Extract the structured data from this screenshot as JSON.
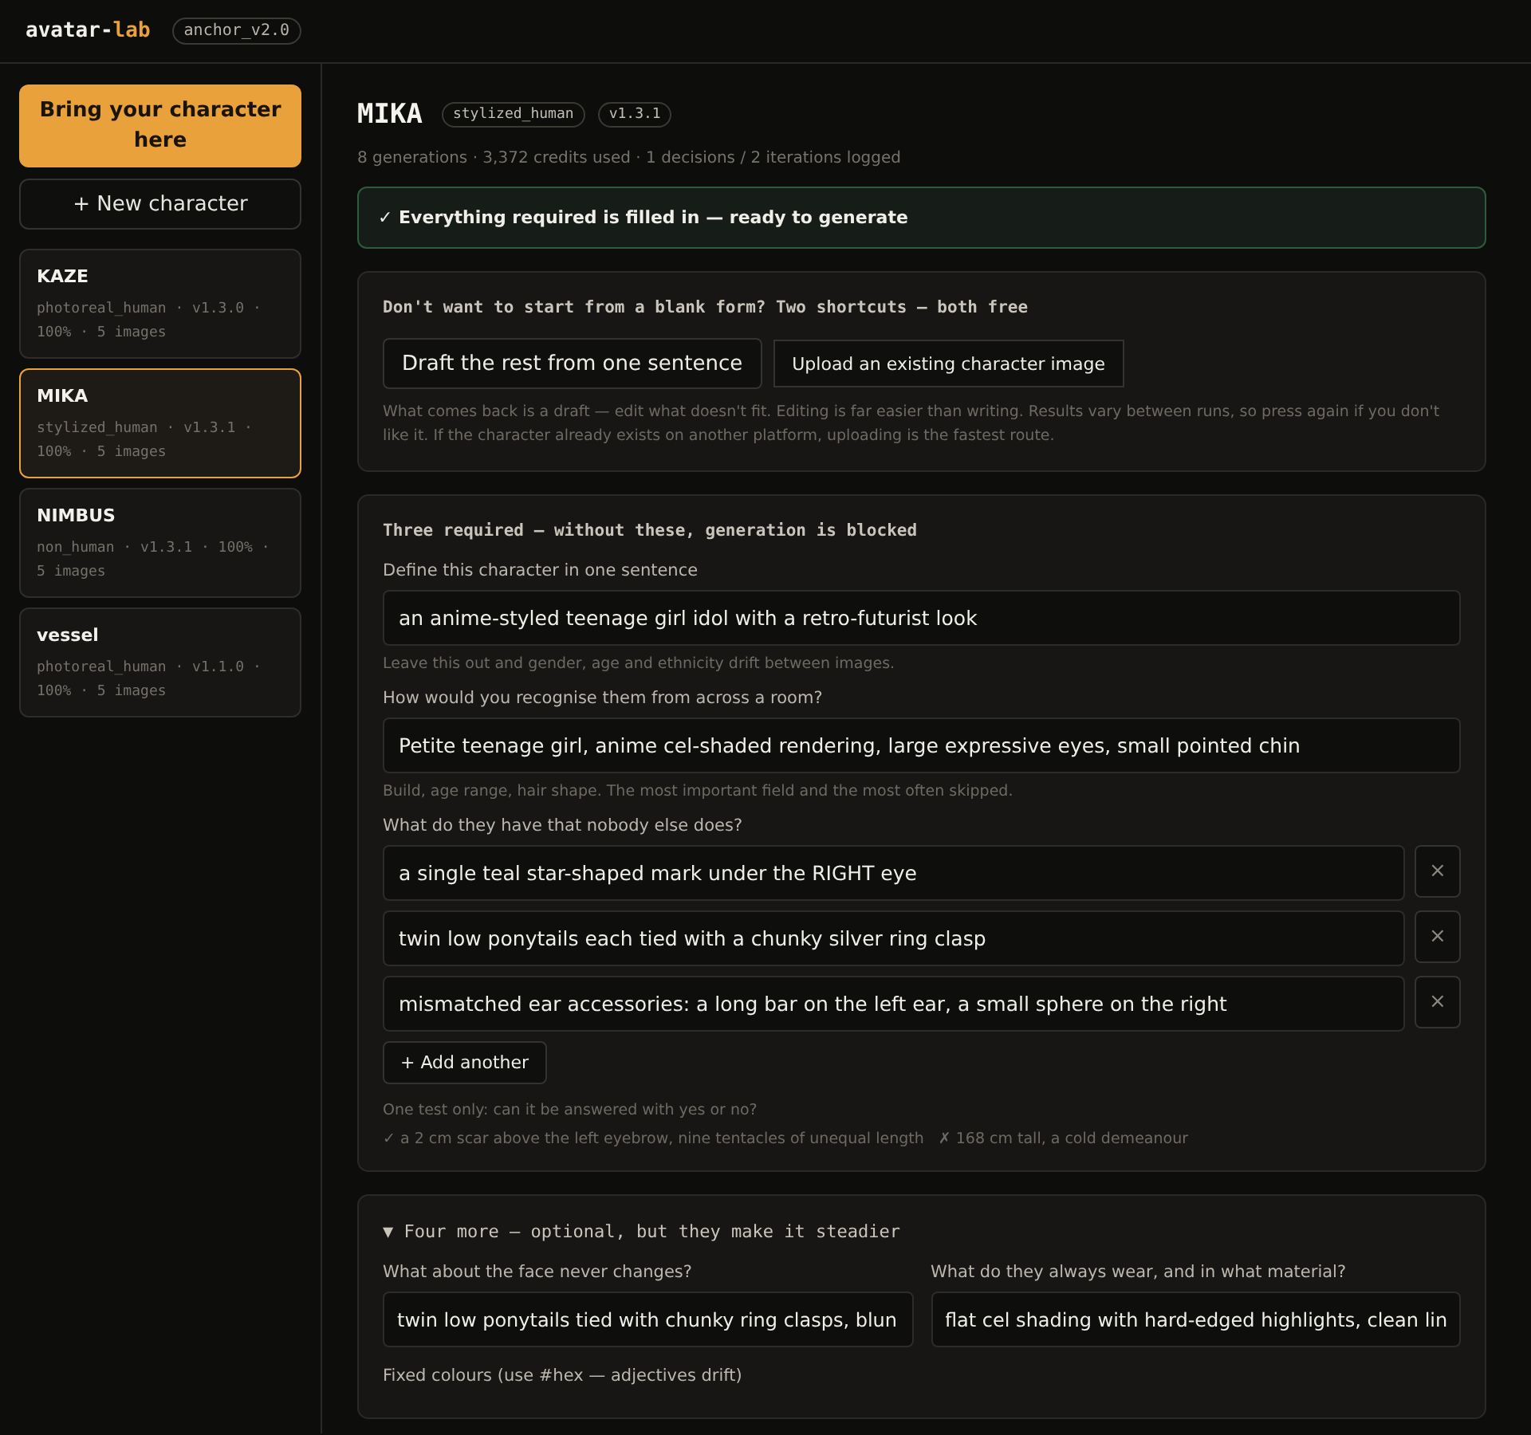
{
  "header": {
    "logo_prefix": "avatar-",
    "logo_accent": "lab",
    "version_badge": "anchor_v2.0"
  },
  "sidebar": {
    "primary_button": "Bring your character here",
    "new_button": {
      "icon": "+",
      "label": "New character"
    },
    "characters": [
      {
        "name": "KAZE",
        "meta": "photoreal_human · v1.3.0 · 100% · 5 images",
        "selected": false
      },
      {
        "name": "MIKA",
        "meta": "stylized_human · v1.3.1 · 100% · 5 images",
        "selected": true
      },
      {
        "name": "NIMBUS",
        "meta": "non_human · v1.3.1 · 100% · 5 images",
        "selected": false
      },
      {
        "name": "vessel",
        "meta": "photoreal_human · v1.1.0 · 100% · 5 images",
        "selected": false
      }
    ]
  },
  "main": {
    "title": "MIKA",
    "tags": [
      "stylized_human",
      "v1.3.1"
    ],
    "stats": "8 generations · 3,372 credits used · 1 decisions / 2 iterations logged",
    "status_banner": {
      "icon": "✓",
      "text": "Everything required is filled in — ready to generate"
    },
    "shortcuts": {
      "heading": "Don't want to start from a blank form? Two shortcuts — both free",
      "buttons": [
        {
          "kind": "large",
          "label": "Draft the rest from one sentence"
        },
        {
          "kind": "small",
          "label": "Upload an existing character image"
        }
      ],
      "note": "What comes back is a draft — edit what doesn't fit. Editing is far easier than writing. Results vary between runs, so press again if you don't like it. If the character already exists on another platform, uploading is the fastest route."
    },
    "required": {
      "heading": "Three required — without these, generation is blocked",
      "fields": [
        {
          "label": "Define this character in one sentence",
          "value": "an anime-styled teenage girl idol with a retro-futurist look",
          "hint": "Leave this out and gender, age and ethnicity drift between images."
        },
        {
          "label": "How would you recognise them from across a room?",
          "value": "Petite teenage girl, anime cel-shaded rendering, large expressive eyes, small pointed chin",
          "hint": "Build, age range, hair shape. The most important field and the most often skipped."
        }
      ],
      "distinctive": {
        "label": "What do they have that nobody else does?",
        "items": [
          {
            "value": "a single teal star-shaped mark under the RIGHT eye",
            "remove_icon": "×"
          },
          {
            "value": "twin low ponytails each tied with a chunky silver ring clasp",
            "remove_icon": "×"
          },
          {
            "value": "mismatched ear accessories: a long bar on the left ear, a small sphere on the right",
            "remove_icon": "×"
          }
        ],
        "add_button": {
          "icon": "+",
          "label": "Add another"
        },
        "hint": "One test only: can it be answered with yes or no?",
        "examples": [
          {
            "mark": "✓",
            "text": "a 2 cm scar above the left eyebrow, nine tentacles of unequal length"
          },
          {
            "mark": "✗",
            "text": "168 cm tall, a cold demeanour"
          }
        ]
      }
    },
    "optional": {
      "expanded": true,
      "caret": "▼",
      "heading": "Four more — optional, but they make it steadier",
      "fields": [
        {
          "label": "What about the face never changes?",
          "value": "twin low ponytails tied with chunky ring clasps, blun"
        },
        {
          "label": "What do they always wear, and in what material?",
          "value": "flat cel shading with hard-edged highlights, clean lin"
        }
      ],
      "next_label": "Fixed colours (use #hex — adjectives drift)"
    }
  }
}
